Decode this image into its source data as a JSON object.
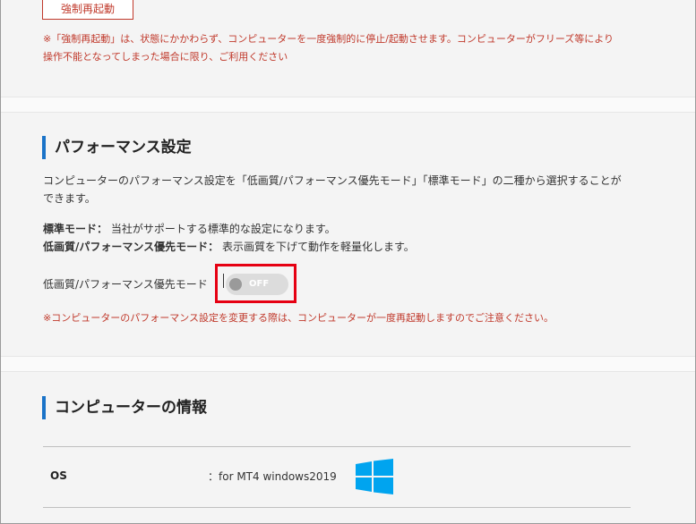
{
  "restart": {
    "button_label": "強制再起動",
    "note_line1": "※「強制再起動」は、状態にかかわらず、コンピューターを一度強制的に停止/起動させます。コンピューターがフリーズ等により",
    "note_line2": "操作不能となってしまった場合に限り、ご利用ください"
  },
  "performance": {
    "heading": "パフォーマンス設定",
    "desc_line1": "コンピューターのパフォーマンス設定を「低画質/パフォーマンス優先モード」「標準モード」の二種から選択することが",
    "desc_line2": "できます。",
    "standard_label": "標準モード：",
    "standard_text": " 当社がサポートする標準的な設定になります。",
    "low_label": "低画質/パフォーマンス優先モード：",
    "low_text": " 表示画質を下げて動作を軽量化します。",
    "toggle_label": "低画質/パフォーマンス優先モード",
    "toggle_state": "OFF",
    "warning": "※コンピューターのパフォーマンス設定を変更する際は、コンピューターが一度再起動しますのでご注意ください。"
  },
  "computer_info": {
    "heading": "コンピューターの情報",
    "os_label": "OS",
    "os_value": "：for MT4 windows2019",
    "os_icon": "windows-logo-icon"
  },
  "colors": {
    "accent_blue": "#1a73c8",
    "warning_red": "#c0392b",
    "highlight_red": "#e60012",
    "windows_blue": "#00a4ef"
  }
}
